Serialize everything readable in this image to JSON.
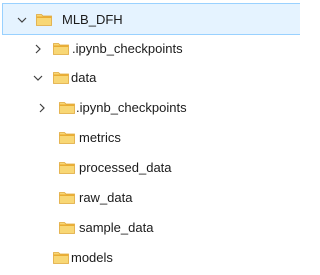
{
  "tree": {
    "items": [
      {
        "label": "MLB_DFH",
        "expanded": true,
        "icon": "folder-icon"
      },
      {
        "label": ".ipynb_checkpoints",
        "expanded": false,
        "icon": "folder-icon"
      },
      {
        "label": "data",
        "expanded": true,
        "icon": "folder-icon"
      },
      {
        "label": ".ipynb_checkpoints",
        "expanded": false,
        "icon": "folder-icon"
      },
      {
        "label": "metrics",
        "icon": "folder-icon"
      },
      {
        "label": "processed_data",
        "icon": "folder-icon"
      },
      {
        "label": "raw_data",
        "icon": "folder-icon"
      },
      {
        "label": "sample_data",
        "icon": "folder-icon"
      },
      {
        "label": "models",
        "icon": "folder-icon"
      }
    ]
  },
  "colors": {
    "selection_bg": "#e5f3ff",
    "selection_border": "#99d1ff",
    "folder_body": "#f8d775",
    "folder_tab": "#e8a92d"
  }
}
